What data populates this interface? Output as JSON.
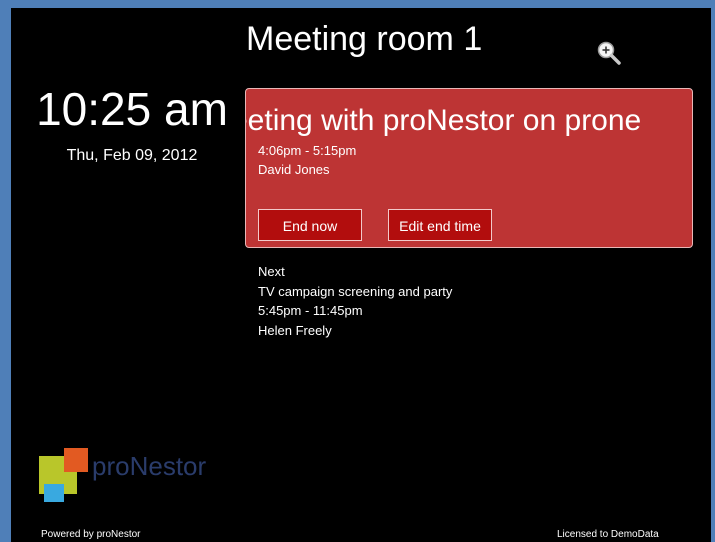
{
  "room": {
    "title": "Meeting room 1"
  },
  "clock": {
    "time": "10:25 am",
    "date": "Thu, Feb 09, 2012"
  },
  "current_meeting": {
    "title": "Meeting with proNestor on prone",
    "time": "4:06pm - 5:15pm",
    "organizer": "David Jones",
    "end_now_label": "End now",
    "edit_end_label": "Edit end time"
  },
  "next_meeting": {
    "heading": "Next",
    "title": "TV campaign screening and party",
    "time": "5:45pm - 11:45pm",
    "organizer": "Helen Freely"
  },
  "brand": {
    "logo_text": "proNestor"
  },
  "footer": {
    "powered_by": "Powered by proNestor",
    "license": "Licensed to DemoData"
  },
  "colors": {
    "background": "#000000",
    "frame": "#4f7fb8",
    "card": "#bd3434",
    "button": "#b20d0d"
  },
  "icons": {
    "zoom": "zoom-in-icon",
    "logo": "pronestor-logo-icon"
  }
}
